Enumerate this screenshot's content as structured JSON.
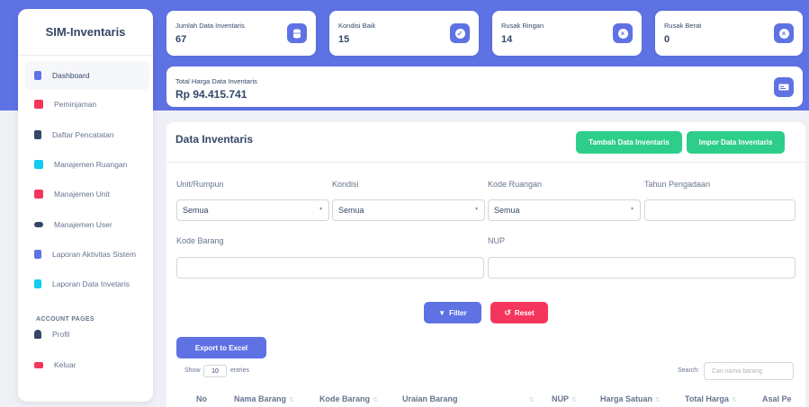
{
  "brand": "SIM-Inventaris",
  "sidebar": {
    "items": [
      {
        "label": "Dashboard",
        "icon": "file-icon",
        "color": "#5e72e4"
      },
      {
        "label": "Peminjaman",
        "icon": "inbox-icon",
        "color": "#f5365c"
      },
      {
        "label": "Daftar Pencatatan",
        "icon": "clipboard-icon",
        "color": "#344767"
      },
      {
        "label": "Manajemen Ruangan",
        "icon": "building-icon",
        "color": "#11cdef"
      },
      {
        "label": "Manajemen Unit",
        "icon": "building-icon",
        "color": "#f5365c"
      },
      {
        "label": "Manajemen User",
        "icon": "users-icon",
        "color": "#344767"
      },
      {
        "label": "Laporan Aktivitas Sistem",
        "icon": "file-icon",
        "color": "#5e72e4"
      },
      {
        "label": "Laporan Data Invetaris",
        "icon": "file-icon",
        "color": "#11cdef"
      }
    ],
    "section_label": "ACCOUNT PAGES",
    "account_items": [
      {
        "label": "Profil",
        "icon": "user-icon",
        "color": "#344767"
      },
      {
        "label": "Keluar",
        "icon": "logout-icon",
        "color": "#f5365c"
      }
    ]
  },
  "stats": [
    {
      "label": "Jumlah Data Inventaris",
      "value": "67",
      "icon": "database-icon"
    },
    {
      "label": "Kondisi Baik",
      "value": "15",
      "icon": "check-circle-icon"
    },
    {
      "label": "Rusak Ringan",
      "value": "14",
      "icon": "x-circle-icon"
    },
    {
      "label": "Rusak Berat",
      "value": "0",
      "icon": "x-circle-icon"
    }
  ],
  "total": {
    "label": "Total Harga Data Inventaris",
    "value": "Rp 94.415.741",
    "icon": "money-icon"
  },
  "panel": {
    "title": "Data Inventaris",
    "add_button": "Tambah Data Inventaris",
    "import_button": "Impor Data Inventaris",
    "filters": {
      "unit_label": "Unit/Rumpun",
      "unit_value": "Semua",
      "kondisi_label": "Kondisi",
      "kondisi_value": "Semua",
      "ruangan_label": "Kode Ruangan",
      "ruangan_value": "Semua",
      "tahun_label": "Tahun Pengadaan",
      "tahun_value": "",
      "kode_label": "Kode Barang",
      "kode_value": "",
      "nup_label": "NUP",
      "nup_value": ""
    },
    "filter_button": "Filter",
    "reset_button": "Reset",
    "export_button": "Export to Excel",
    "show_label": "Show",
    "entries_value": "10",
    "entries_label": "entries",
    "search_label": "Search:",
    "search_placeholder": "Cari nama barang",
    "columns": [
      "No",
      "Nama Barang",
      "Kode Barang",
      "Uraian Barang",
      "NUP",
      "Harga Satuan",
      "Total Harga",
      "Asal Pe"
    ]
  },
  "colors": {
    "accent": "#5e72e4",
    "green": "#2dce89",
    "red": "#f5365c"
  }
}
